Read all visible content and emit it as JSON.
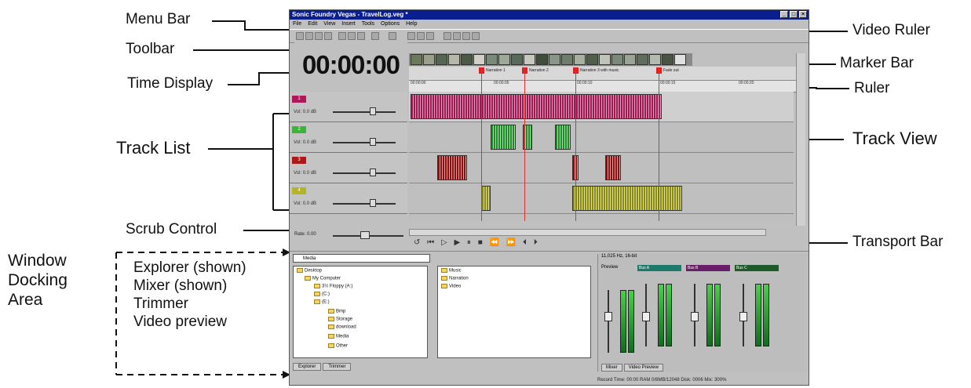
{
  "callouts": {
    "menu_bar": "Menu Bar",
    "toolbar": "Toolbar",
    "time_display": "Time Display",
    "track_list": "Track List",
    "scrub_control": "Scrub Control",
    "video_ruler": "Video Ruler",
    "marker_bar": "Marker Bar",
    "ruler": "Ruler",
    "track_view": "Track View",
    "transport_bar": "Transport Bar",
    "window_docking_area": [
      "Window",
      "Docking",
      "Area"
    ],
    "docking_items": [
      "Explorer (shown)",
      "Mixer (shown)",
      "Trimmer",
      "Video preview"
    ]
  },
  "app": {
    "title": "Sonic Foundry Vegas - TravelLog.veg *",
    "menu": [
      "File",
      "Edit",
      "View",
      "Insert",
      "Tools",
      "Options",
      "Help"
    ],
    "time": "00:00:00",
    "markers": [
      "Narration 1",
      "Narration 2",
      "Narration 3 with music",
      "Fade out"
    ],
    "ruler_ticks": [
      "00:00:00",
      "00:00:05",
      "00:00:10",
      "00:00:15",
      "00:00:20"
    ],
    "tracks": [
      {
        "num": "1",
        "vol_label": "Vol:",
        "vol_value": "0.0 dB",
        "color": "#b0185a"
      },
      {
        "num": "2",
        "vol_label": "Vol:",
        "vol_value": "0.0 dB",
        "color": "#3cb43c"
      },
      {
        "num": "3",
        "vol_label": "Vol:",
        "vol_value": "0.0 dB",
        "color": "#b01818"
      },
      {
        "num": "4",
        "vol_label": "Vol:",
        "vol_value": "0.0 dB",
        "color": "#b4b428"
      }
    ],
    "rate": "Rate: 0.00",
    "explorer": {
      "location": "Media",
      "tree": [
        "Desktop",
        "My Computer",
        "3½ Floppy (A:)",
        "(C:)",
        "(E:)",
        "Bmp",
        "Storage",
        "download",
        "Media",
        "Other"
      ],
      "files": [
        "Music",
        "Narration",
        "Video"
      ],
      "tabs": [
        "Explorer",
        "Trimmer"
      ]
    },
    "mixer": {
      "info": "11,025 Hz, 16-bit",
      "preview_label": "Preview",
      "buses": [
        "Bus A",
        "Bus B",
        "Bus C"
      ],
      "tabs": [
        "Mixer",
        "Video Preview"
      ]
    },
    "status": "Record Time: 00:00   RAM 0/8MB/12048   Disk: 0006   Mix: 300%"
  }
}
